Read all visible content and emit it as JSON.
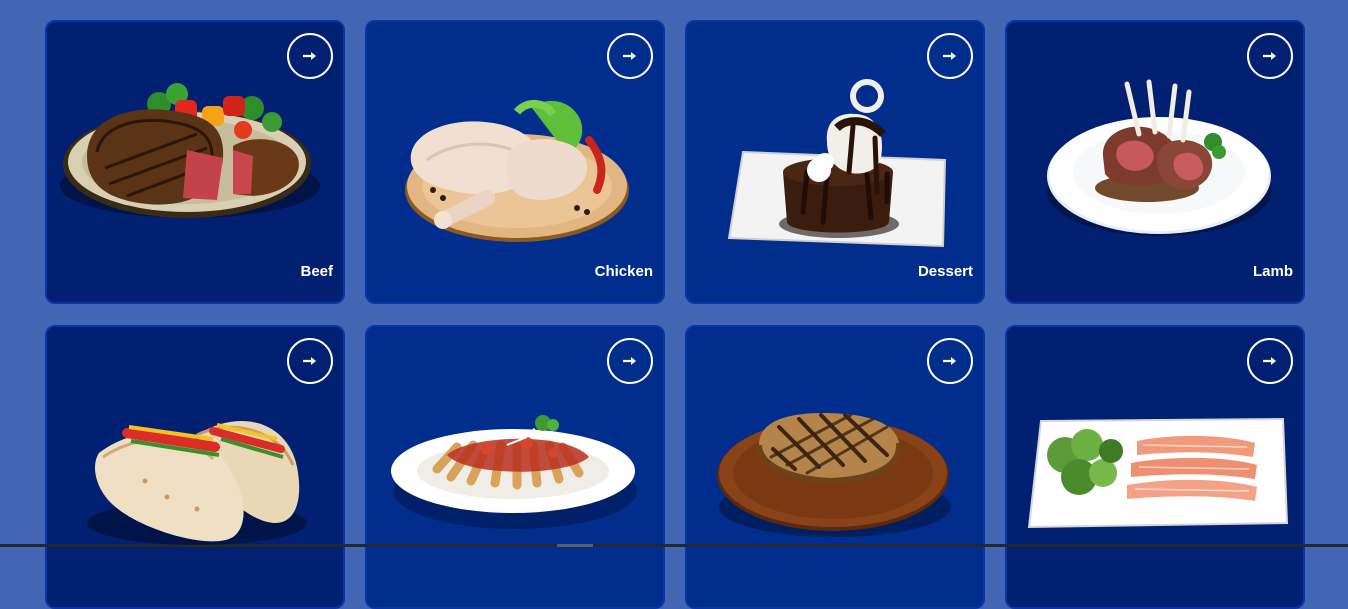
{
  "categories": [
    {
      "label": "Beef",
      "icon": "arrow-right-icon"
    },
    {
      "label": "Chicken",
      "icon": "arrow-right-icon"
    },
    {
      "label": "Dessert",
      "icon": "arrow-right-icon"
    },
    {
      "label": "Lamb",
      "icon": "arrow-right-icon"
    },
    {
      "label": "",
      "icon": "arrow-right-icon"
    },
    {
      "label": "",
      "icon": "arrow-right-icon"
    },
    {
      "label": "",
      "icon": "arrow-right-icon"
    },
    {
      "label": "",
      "icon": "arrow-right-icon"
    }
  ],
  "colors": {
    "page_background": "#4266b3",
    "card_dark": "#022071",
    "card_mid": "#012d8c",
    "card_border": "#0a35a6",
    "text": "#ffffff"
  }
}
